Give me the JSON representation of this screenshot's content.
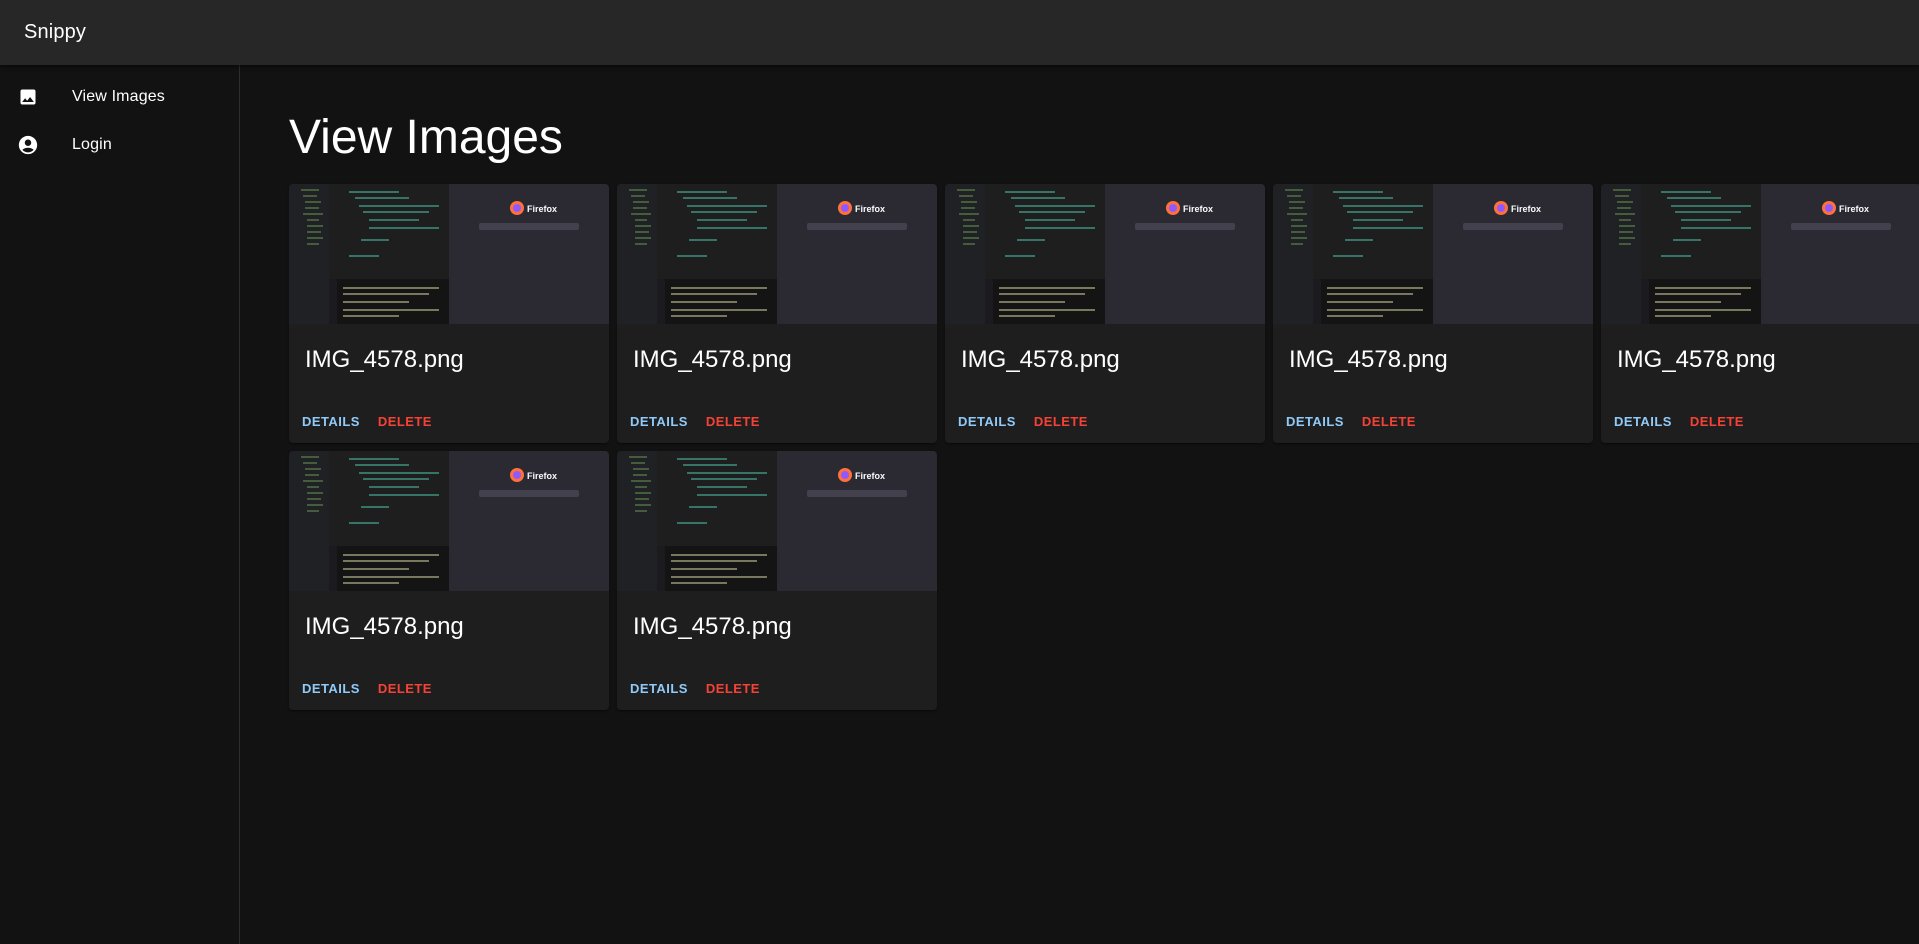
{
  "app": {
    "title": "Snippy"
  },
  "sidebar": {
    "items": [
      {
        "label": "View Images",
        "icon": "image-icon"
      },
      {
        "label": "Login",
        "icon": "account-circle-icon"
      }
    ]
  },
  "main": {
    "title": "View Images",
    "cards": [
      {
        "filename": "IMG_4578.png",
        "details_label": "DETAILS",
        "delete_label": "DELETE"
      },
      {
        "filename": "IMG_4578.png",
        "details_label": "DETAILS",
        "delete_label": "DELETE"
      },
      {
        "filename": "IMG_4578.png",
        "details_label": "DETAILS",
        "delete_label": "DELETE"
      },
      {
        "filename": "IMG_4578.png",
        "details_label": "DETAILS",
        "delete_label": "DELETE"
      },
      {
        "filename": "IMG_4578.png",
        "details_label": "DETAILS",
        "delete_label": "DELETE"
      },
      {
        "filename": "IMG_4578.png",
        "details_label": "DETAILS",
        "delete_label": "DELETE"
      },
      {
        "filename": "IMG_4578.png",
        "details_label": "DETAILS",
        "delete_label": "DELETE"
      }
    ],
    "thumbnail": {
      "browser_name": "Firefox"
    }
  },
  "colors": {
    "appbar": "#272727",
    "background": "#121212",
    "card": "#1e1e1e",
    "primary": "#90caf9",
    "error": "#f44336"
  }
}
